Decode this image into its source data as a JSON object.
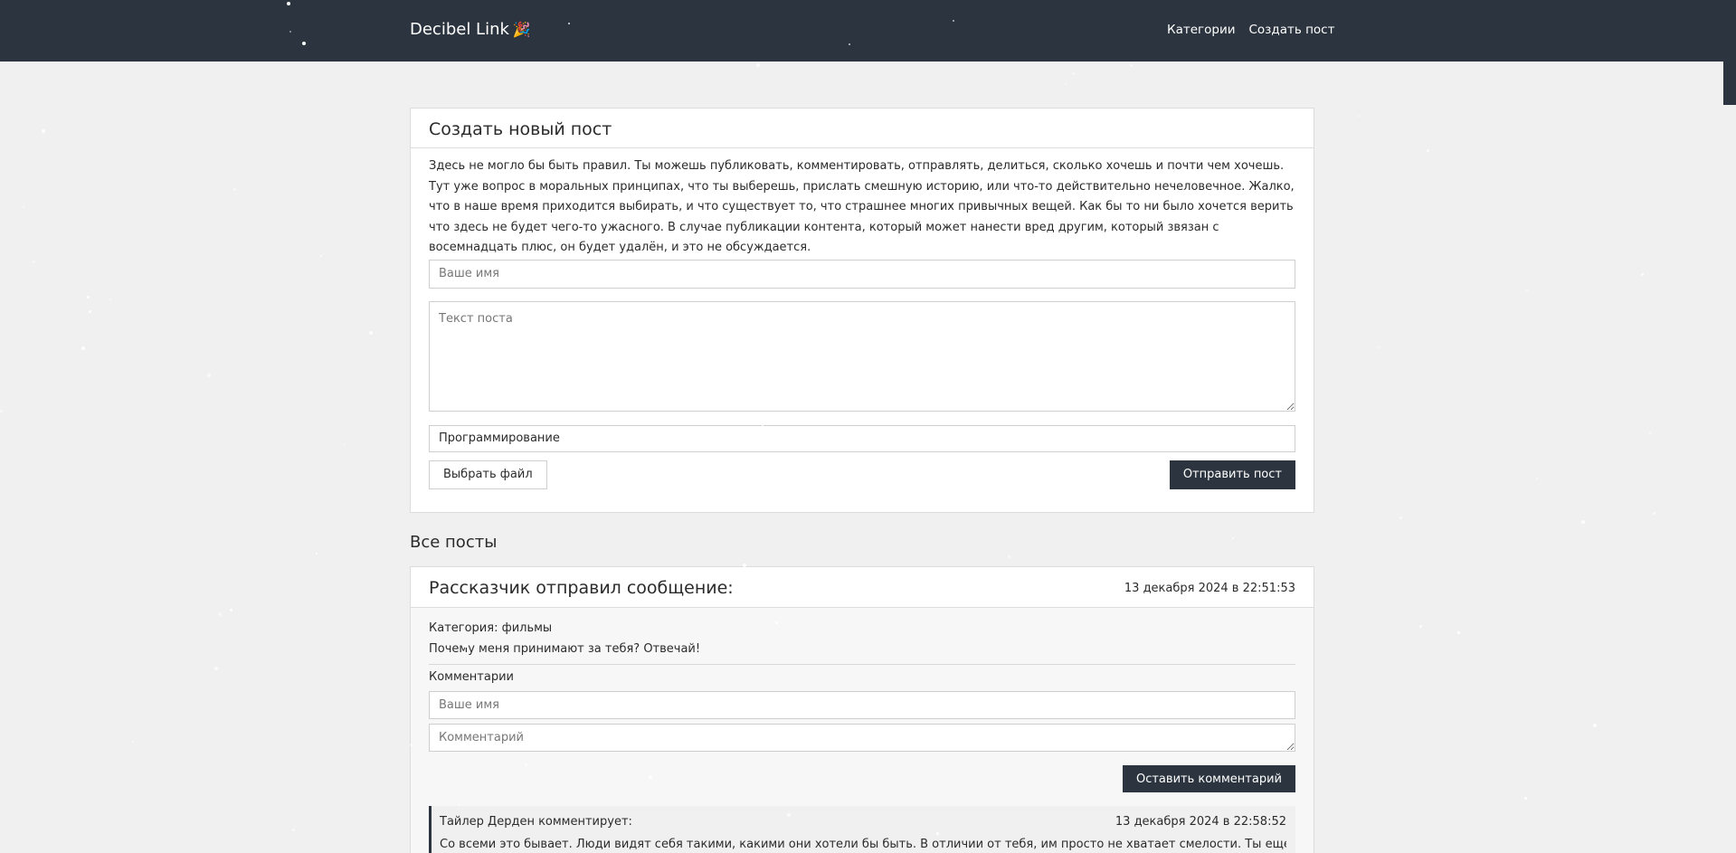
{
  "nav": {
    "brand": "Decibel Link",
    "brand_emoji": "🎉",
    "links": [
      "Категории",
      "Создать пост"
    ]
  },
  "create_post": {
    "title": "Создать новый пост",
    "intro": "Здесь не могло бы быть правил. Ты можешь публиковать, комментировать, отправлять, делиться, сколько хочешь и почти чем хочешь. Тут уже вопрос в моральных принципах, что ты выберешь, прислать смешную историю, или что-то действительно нечеловечное. Жалко, что в наше время приходится выбирать, и что существует то, что страшнее многих привычных вещей. Как бы то ни было хочется верить что здесь не будет чего-то ужасного. В случае публикации контента, который может нанести вред другим, который звязан с восемнадцать плюс, он будет удалён, и это не обсуждается.",
    "name_placeholder": "Ваше имя",
    "text_placeholder": "Текст поста",
    "category_value": "Программирование",
    "file_button": "Выбрать файл",
    "submit_button": "Отправить пост"
  },
  "all_posts_title": "Все посты",
  "post": {
    "title": "Рассказчик отправил сообщение:",
    "date": "13 декабря 2024 в 22:51:53",
    "category": "Категория: фильмы",
    "text": "Почему меня принимают за тебя? Отвечай!",
    "comments_label": "Комментарии",
    "comment_name_placeholder": "Ваше имя",
    "comment_text_placeholder": "Комментарий",
    "comment_button": "Оставить комментарий",
    "comment": {
      "author": "Тайлер Дерден  комментирует:",
      "date": "13 декабря 2024 в 22:58:52",
      "text": "Со всеми это бывает. Люди видят себя такими, какими они хотели бы быть. В отличии от тебя, им просто не хватает смелости. Ты еще борешься с"
    }
  },
  "colors": {
    "nav_bg": "#2c353f",
    "page_bg": "#f0f0f0",
    "accent": "#2c353f"
  }
}
